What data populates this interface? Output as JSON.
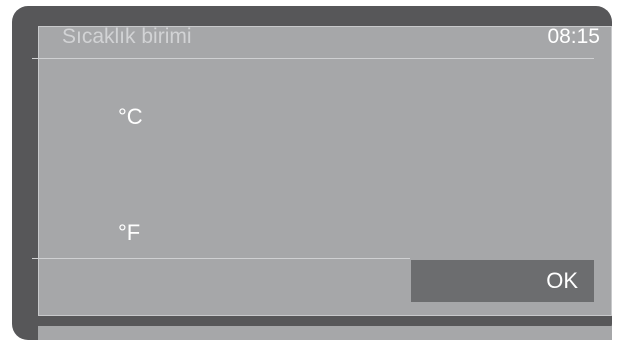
{
  "header": {
    "title": "Sıcaklık birimi",
    "time": "08:15"
  },
  "options": [
    {
      "label": "°C"
    },
    {
      "label": "°F"
    }
  ],
  "footer": {
    "ok_label": "OK"
  }
}
